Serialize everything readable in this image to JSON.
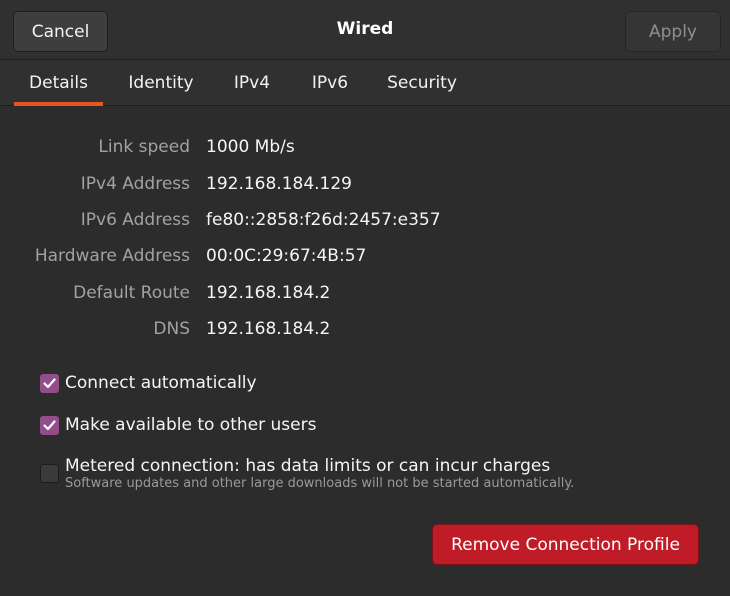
{
  "header": {
    "title": "Wired",
    "cancel_label": "Cancel",
    "apply_label": "Apply"
  },
  "tabs": [
    {
      "label": "Details",
      "active": true
    },
    {
      "label": "Identity",
      "active": false
    },
    {
      "label": "IPv4",
      "active": false
    },
    {
      "label": "IPv6",
      "active": false
    },
    {
      "label": "Security",
      "active": false
    }
  ],
  "details": [
    {
      "label": "Link speed",
      "value": "1000 Mb/s"
    },
    {
      "label": "IPv4 Address",
      "value": "192.168.184.129"
    },
    {
      "label": "IPv6 Address",
      "value": "fe80::2858:f26d:2457:e357"
    },
    {
      "label": "Hardware Address",
      "value": "00:0C:29:67:4B:57"
    },
    {
      "label": "Default Route",
      "value": "192.168.184.2"
    },
    {
      "label": "DNS",
      "value": "192.168.184.2"
    }
  ],
  "options": [
    {
      "label": "Connect automatically",
      "checked": true
    },
    {
      "label": "Make available to other users",
      "checked": true
    },
    {
      "label": "Metered connection: has data limits or can incur charges",
      "checked": false,
      "sublabel": "Software updates and other large downloads will not be started automatically."
    }
  ],
  "remove_label": "Remove Connection Profile",
  "colors": {
    "accent_tab": "#e95420",
    "checkbox_checked": "#924d8b",
    "destructive": "#c01c28",
    "background": "#2c2c2c"
  },
  "icons": {
    "checkmark": "check-icon"
  }
}
